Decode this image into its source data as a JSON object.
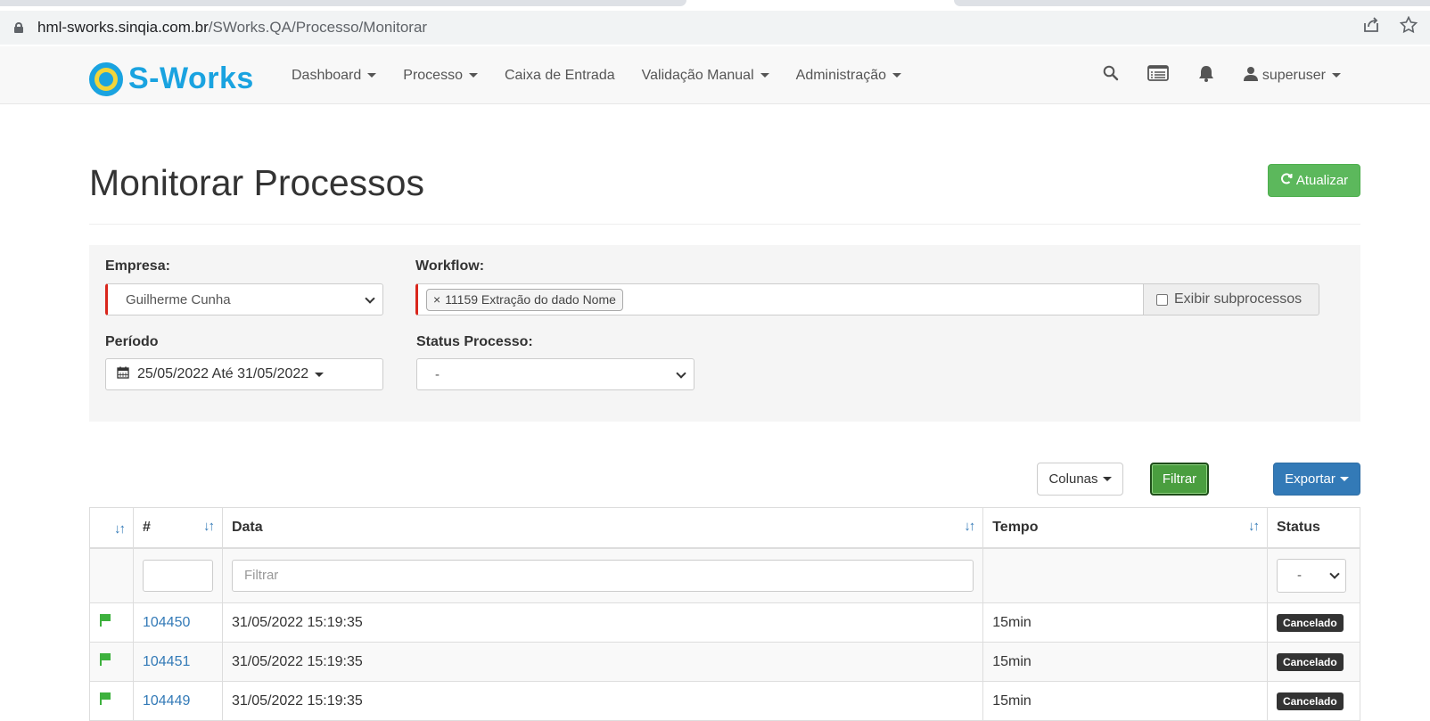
{
  "browser": {
    "url_host": "hml-sworks.sinqia.com.br",
    "url_path": "/SWorks.QA/Processo/Monitorar"
  },
  "navbar": {
    "brand": "S-Works",
    "items": [
      {
        "label": "Dashboard",
        "dropdown": true
      },
      {
        "label": "Processo",
        "dropdown": true
      },
      {
        "label": "Caixa de Entrada",
        "dropdown": false
      },
      {
        "label": "Validação Manual",
        "dropdown": true
      },
      {
        "label": "Administração",
        "dropdown": true
      }
    ],
    "user": "superuser",
    "icons": [
      "search-icon",
      "list-icon",
      "bell-icon",
      "user-icon"
    ]
  },
  "page": {
    "title": "Monitorar Processos",
    "update_button": "Atualizar"
  },
  "filters": {
    "empresa_label": "Empresa:",
    "empresa_value": "Guilherme Cunha",
    "workflow_label": "Workflow:",
    "workflow_tag": "11159 Extração do dado Nome",
    "subprocess_label": "Exibir subprocessos",
    "periodo_label": "Período",
    "periodo_value": "25/05/2022 Até 31/05/2022",
    "status_label": "Status Processo:",
    "status_value": "-"
  },
  "toolbar": {
    "columns": "Colunas",
    "filter": "Filtrar",
    "export": "Exportar"
  },
  "table": {
    "headers": [
      "#",
      "Data",
      "Tempo",
      "Status"
    ],
    "data_filter_placeholder": "Filtrar",
    "status_filter_value": "-",
    "rows": [
      {
        "id": "104450",
        "data": "31/05/2022 15:19:35",
        "tempo": "15min",
        "status": "Cancelado"
      },
      {
        "id": "104451",
        "data": "31/05/2022 15:19:35",
        "tempo": "15min",
        "status": "Cancelado"
      },
      {
        "id": "104449",
        "data": "31/05/2022 15:19:35",
        "tempo": "15min",
        "status": "Cancelado"
      }
    ]
  },
  "colors": {
    "brand": "#1aa3e0",
    "success": "#5cb85c",
    "primary": "#337ab7",
    "required": "#d9261c",
    "flag": "#3db13d"
  }
}
